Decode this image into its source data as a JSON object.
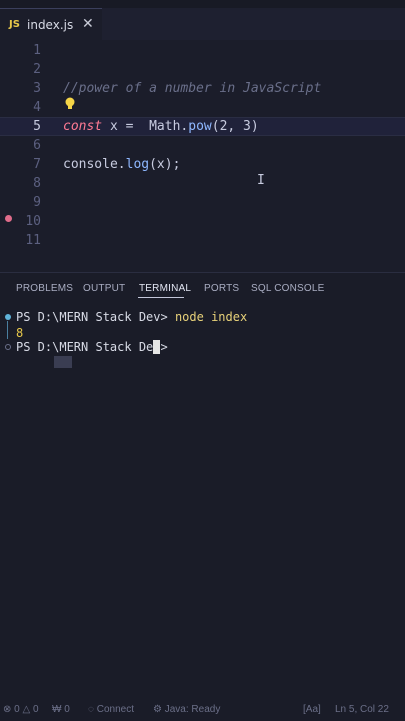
{
  "tab": {
    "icon": "JS",
    "filename": "index.js",
    "close": "✕"
  },
  "editor": {
    "line_numbers": [
      "1",
      "2",
      "3",
      "4",
      "5",
      "6",
      "7",
      "8",
      "9",
      "10",
      "11"
    ],
    "comment": "//power of a number in JavaScript",
    "line5": {
      "kw": "const",
      "rest1": " x =  ",
      "obj": "Math",
      "dot": ".",
      "fn": "pow",
      "open": "(",
      "a": "2",
      "comma": ", ",
      "b": "3",
      "close": ")"
    },
    "line7": {
      "obj": "console",
      "dot": ".",
      "fn": "log",
      "args": "(x);"
    },
    "cursor_glyph": "I"
  },
  "panel": {
    "tabs": [
      "PROBLEMS",
      "OUTPUT",
      "TERMINAL",
      "PORTS",
      "SQL CONSOLE"
    ],
    "active_tab": "TERMINAL"
  },
  "terminal": {
    "prompt1": "PS D:\\MERN Stack Dev> ",
    "cmd1": "node index",
    "output": "8",
    "prompt2": "PS D:\\MERN Stack Dev> "
  },
  "statusbar": {
    "errors": "⊗ 0 △ 0",
    "warnings": "₩ 0",
    "connect": "◌ Connect",
    "java": "⚙ Java: Ready",
    "aa": "[Aa]",
    "position": "Ln 5, Col 22"
  },
  "colors": {
    "editor_bg": "#1b1d2a",
    "keyword": "#ff7a93",
    "function": "#8fb8ff",
    "number": "#ff9e64",
    "terminal_output": "#e8c84a"
  }
}
